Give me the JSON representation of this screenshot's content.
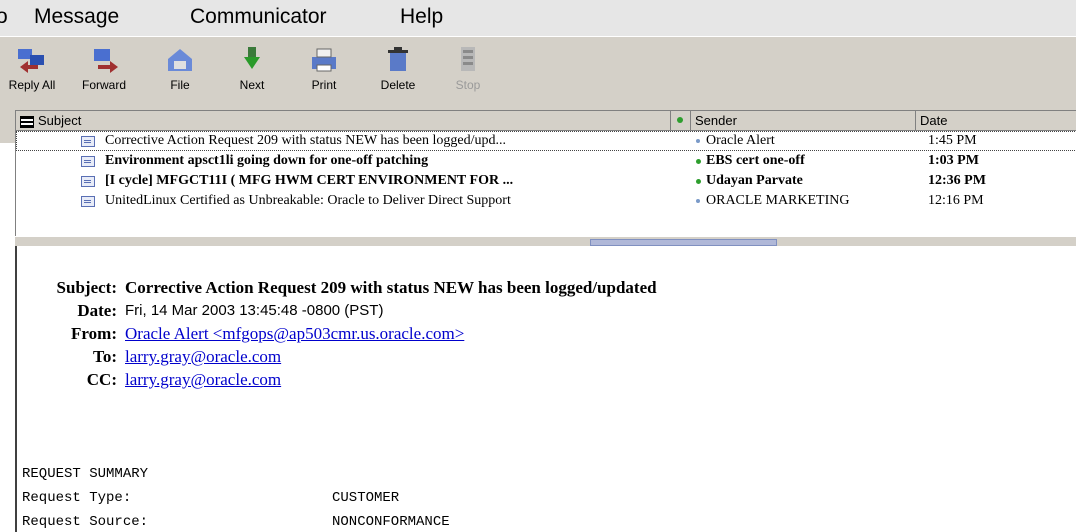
{
  "menu": {
    "items": [
      "o",
      "Message",
      "Communicator",
      "Help"
    ]
  },
  "toolbar": {
    "buttons": [
      {
        "label": "Reply All",
        "icon": "reply-all-icon"
      },
      {
        "label": "Forward",
        "icon": "forward-icon"
      },
      {
        "label": "File",
        "icon": "file-icon"
      },
      {
        "label": "Next",
        "icon": "next-icon"
      },
      {
        "label": "Print",
        "icon": "print-icon"
      },
      {
        "label": "Delete",
        "icon": "delete-icon"
      },
      {
        "label": "Stop",
        "icon": "stop-icon"
      }
    ]
  },
  "list": {
    "columns": {
      "subject": "Subject",
      "sender": "Sender",
      "date": "Date"
    },
    "rows": [
      {
        "subject": "Corrective Action Request 209 with status NEW has been logged/upd...",
        "sender": "Oracle Alert",
        "date": "1:45 PM",
        "unread": false
      },
      {
        "subject": "Environment apsct1li going down for one-off patching",
        "sender": "EBS cert one-off",
        "date": "1:03 PM",
        "unread": true
      },
      {
        "subject": "[I cycle] MFGCT11I ( MFG HWM CERT ENVIRONMENT FOR ...",
        "sender": "Udayan Parvate",
        "date": "12:36 PM",
        "unread": true
      },
      {
        "subject": "UnitedLinux Certified as Unbreakable: Oracle to Deliver Direct Support",
        "sender": "ORACLE MARKETING",
        "date": "12:16 PM",
        "unread": false
      }
    ]
  },
  "message": {
    "subject_key": "Subject:",
    "subject": "Corrective Action Request 209 with status NEW has been logged/updated",
    "date_key": "Date:",
    "date": "Fri, 14 Mar 2003 13:45:48 -0800 (PST)",
    "from_key": "From:",
    "from": "Oracle Alert <mfgops@ap503cmr.us.oracle.com>",
    "to_key": "To:",
    "to": "larry.gray@oracle.com",
    "cc_key": "CC:",
    "cc": "larry.gray@oracle.com",
    "body": {
      "heading": "REQUEST SUMMARY",
      "lines": [
        {
          "key": "Request Type:",
          "value": "CUSTOMER"
        },
        {
          "key": "Request Source:",
          "value": "NONCONFORMANCE"
        }
      ]
    }
  },
  "colors": {
    "link": "#0000cc",
    "unread_dot": "#2e9e2e",
    "read_dot": "#7a9ac8"
  }
}
